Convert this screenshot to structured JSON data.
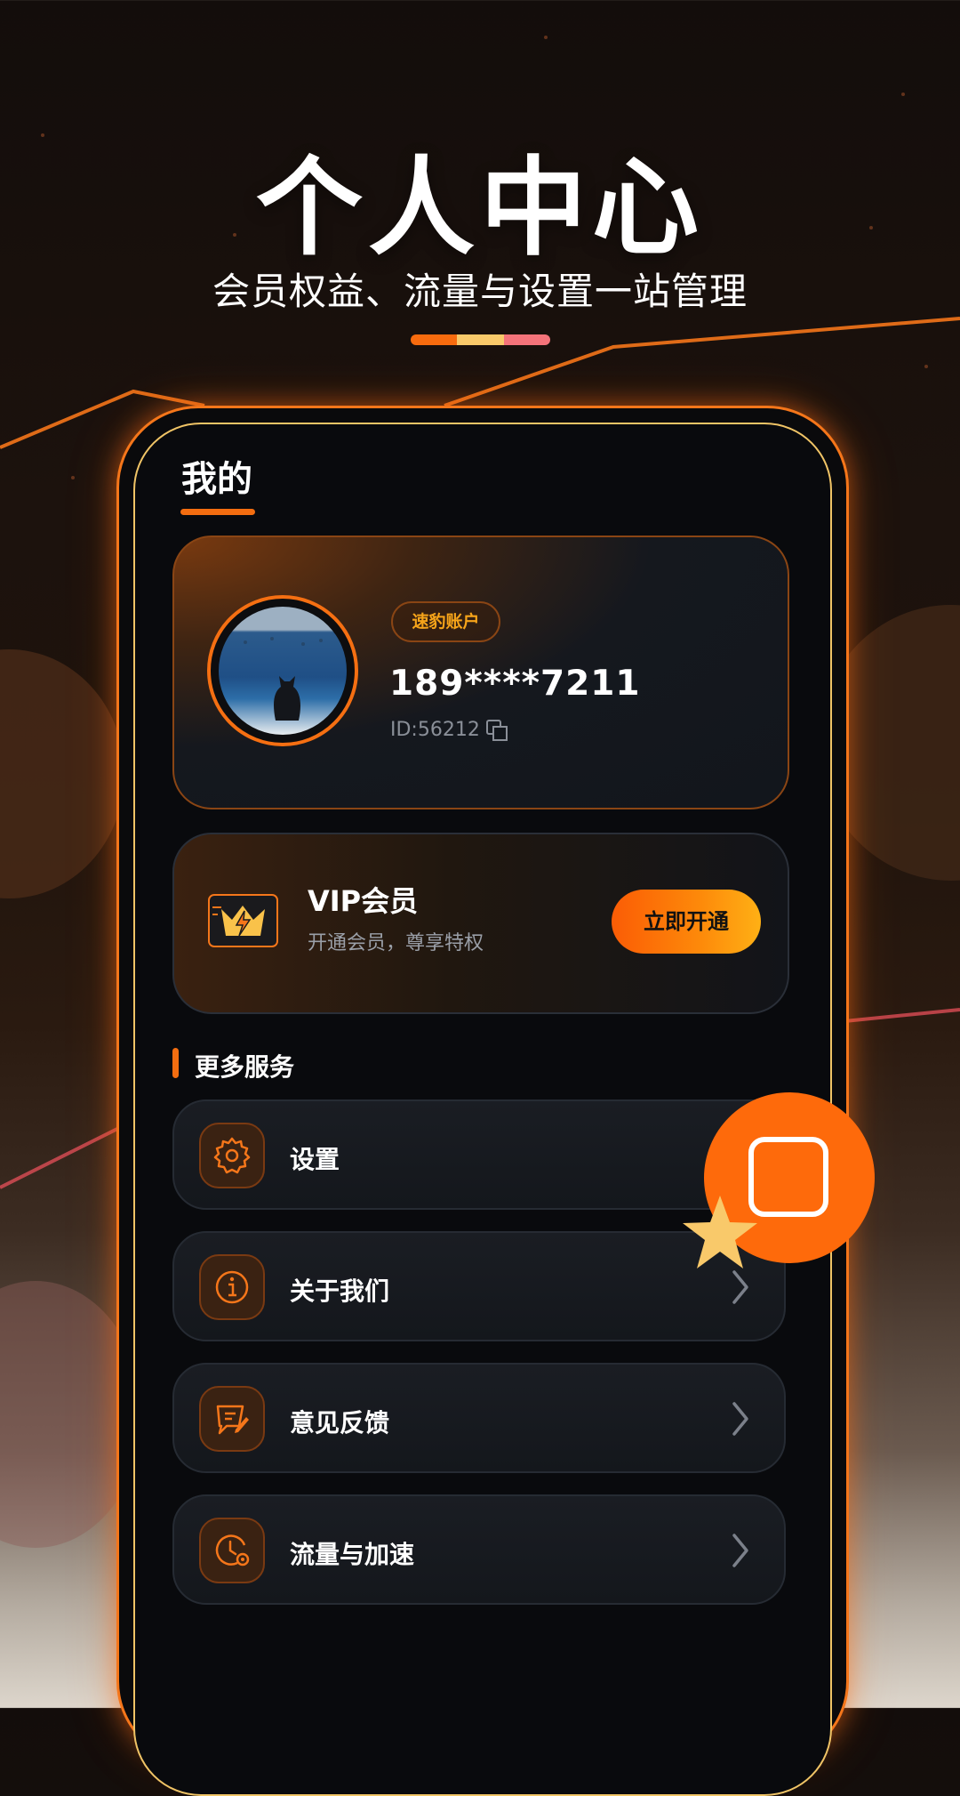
{
  "header": {
    "title": "个人中心",
    "subtitle": "会员权益、流量与设置一站管理",
    "accent_colors": [
      "#f86b0e",
      "#f9c96a",
      "#f4737a"
    ]
  },
  "page": {
    "title": "我的"
  },
  "profile": {
    "badge": "速豹账户",
    "phone": "189****7211",
    "user_id": "ID:56212",
    "avatar_icon": "avatar-photo-cat-sea",
    "copy_icon": "copy-icon"
  },
  "vip": {
    "title": "VIP会员",
    "description": "开通会员，尊享特权",
    "button_label": "立即开通",
    "icon": "crown-lightning-icon"
  },
  "services": {
    "section_title": "更多服务",
    "items": [
      {
        "label": "设置",
        "icon": "gear-icon"
      },
      {
        "label": "关于我们",
        "icon": "info-icon"
      },
      {
        "label": "意见反馈",
        "icon": "feedback-icon"
      },
      {
        "label": "流量与加速",
        "icon": "traffic-clock-icon"
      }
    ]
  },
  "floating_button": {
    "icon": "app-square-icon",
    "decoration": "star-icon"
  },
  "colors": {
    "accent": "#f36d10",
    "badge_text": "#f6a41a",
    "background": "#090a0d"
  }
}
